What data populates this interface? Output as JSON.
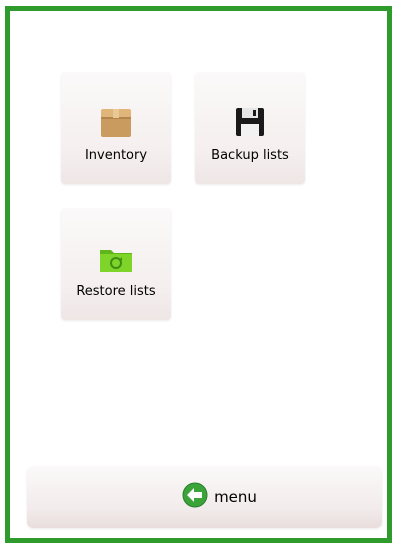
{
  "grid": {
    "items": [
      {
        "label": "Inventory",
        "icon": "box-icon"
      },
      {
        "label": "Backup lists",
        "icon": "floppy-disk-icon"
      },
      {
        "label": "Restore lists",
        "icon": "restore-folder-icon"
      }
    ]
  },
  "menu": {
    "label": "menu",
    "icon": "back-arrow-icon"
  },
  "colors": {
    "frame_border": "#2e9b2c",
    "tile_background": "#f5efef",
    "box_icon": "#c79a5c",
    "folder_icon": "#6cc11f",
    "back_icon": "#3aa33a"
  }
}
